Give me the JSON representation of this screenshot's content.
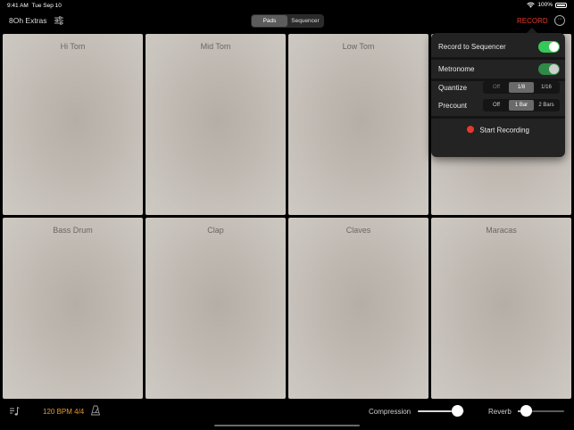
{
  "status_bar": {
    "time": "9:41 AM",
    "date": "Tue Sep 10",
    "battery": "100%",
    "wifi_icon": "wifi-icon"
  },
  "header": {
    "title": "8Oh Extras",
    "mixer_icon": "sliders-icon",
    "tabs": [
      {
        "label": "Pads",
        "active": true
      },
      {
        "label": "Sequencer",
        "active": false
      }
    ],
    "record_label": "RECORD",
    "more_icon": "ellipsis-circle-icon"
  },
  "pads": [
    {
      "label": "Hi Tom"
    },
    {
      "label": "Mid Tom"
    },
    {
      "label": "Low Tom"
    },
    {
      "label": ""
    },
    {
      "label": "Bass Drum"
    },
    {
      "label": "Clap"
    },
    {
      "label": "Claves"
    },
    {
      "label": "Maracas"
    }
  ],
  "record_popover": {
    "record_to_sequencer": {
      "label": "Record to Sequencer",
      "on": true
    },
    "metronome": {
      "label": "Metronome",
      "on": true
    },
    "quantize": {
      "label": "Quantize",
      "options": [
        "Off",
        "1/8",
        "1/16"
      ],
      "selected": "1/8"
    },
    "precount": {
      "label": "Precount",
      "options": [
        "Off",
        "1 Bar",
        "2 Bars"
      ],
      "selected": "1 Bar"
    },
    "start_label": "Start Recording"
  },
  "footer": {
    "note_icon": "music-note-list-icon",
    "tempo": "120 BPM 4/4",
    "metronome_icon": "metronome-icon",
    "compression": {
      "label": "Compression",
      "value": 0.85
    },
    "reverb": {
      "label": "Reverb",
      "value": 0.18
    }
  },
  "colors": {
    "accent_record": "#e6392c",
    "tempo": "#e89a2c",
    "toggle_on": "#35c759",
    "pad": "#c4beb8"
  }
}
